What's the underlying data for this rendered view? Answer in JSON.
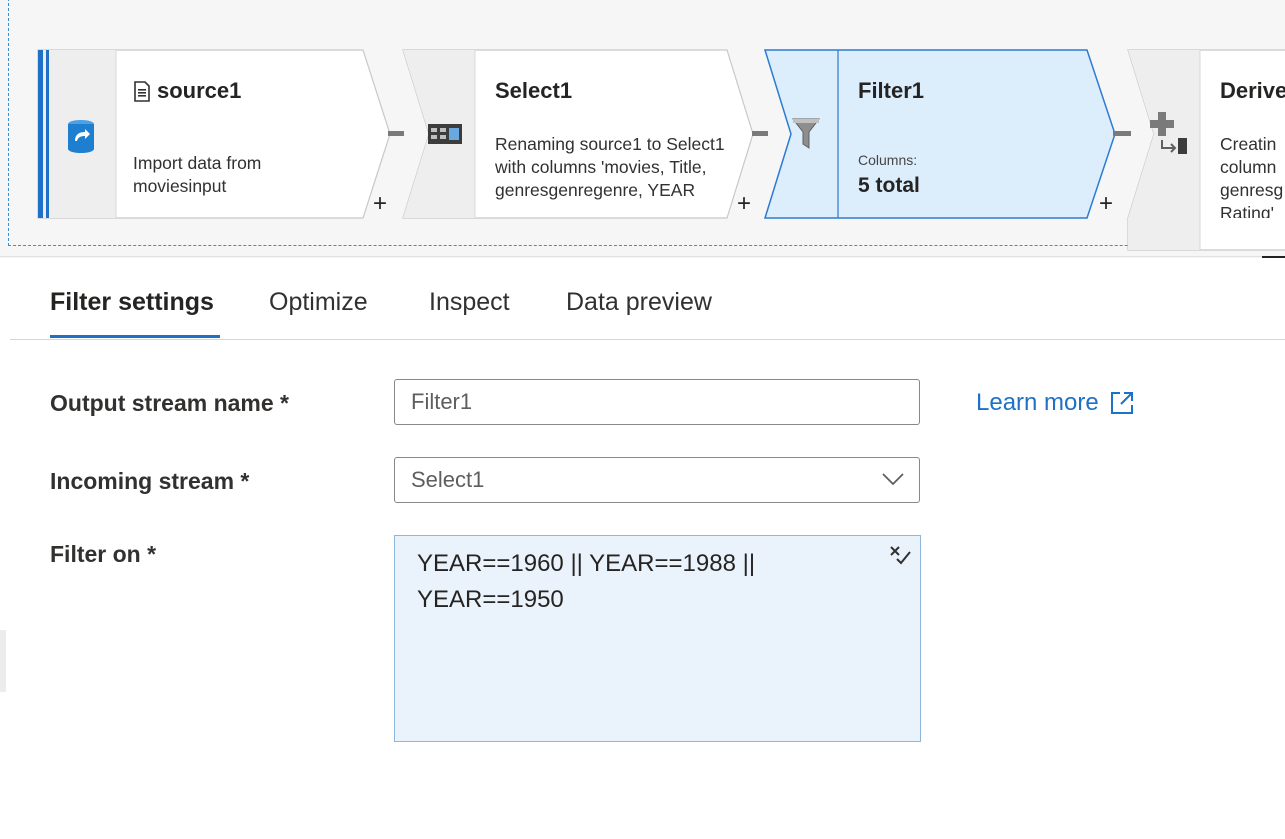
{
  "pipeline": {
    "nodes": [
      {
        "title": "source1",
        "description": "Import data from moviesinput",
        "icon": "file-icon"
      },
      {
        "title": "Select1",
        "description": "Renaming source1 to Select1 with columns 'movies, Title, genresgenregenre, YEAR",
        "icon": "select-columns-icon"
      },
      {
        "title": "Filter1",
        "columns_label": "Columns:",
        "columns_value": "5 total",
        "icon": "funnel-icon"
      },
      {
        "title": "Derive",
        "description": "Creatin column genresg Rating'",
        "icon": "derived-column-icon"
      }
    ],
    "add_label": "+"
  },
  "tabs": [
    {
      "label": "Filter settings",
      "active": true
    },
    {
      "label": "Optimize",
      "active": false
    },
    {
      "label": "Inspect",
      "active": false
    },
    {
      "label": "Data preview",
      "active": false
    }
  ],
  "form": {
    "output_stream": {
      "label": "Output stream name *",
      "value": "Filter1"
    },
    "incoming_stream": {
      "label": "Incoming stream *",
      "value": "Select1"
    },
    "filter_on": {
      "label": "Filter on *",
      "line1": "YEAR==1960 || YEAR==1988 ||",
      "line2": "YEAR==1950"
    },
    "learn_more": "Learn more"
  },
  "colors": {
    "accent": "#1e71c6",
    "selected_node_fill": "#dcedfc",
    "selected_node_border": "#2b7bd1",
    "expression_bg": "#eaf3fb"
  }
}
